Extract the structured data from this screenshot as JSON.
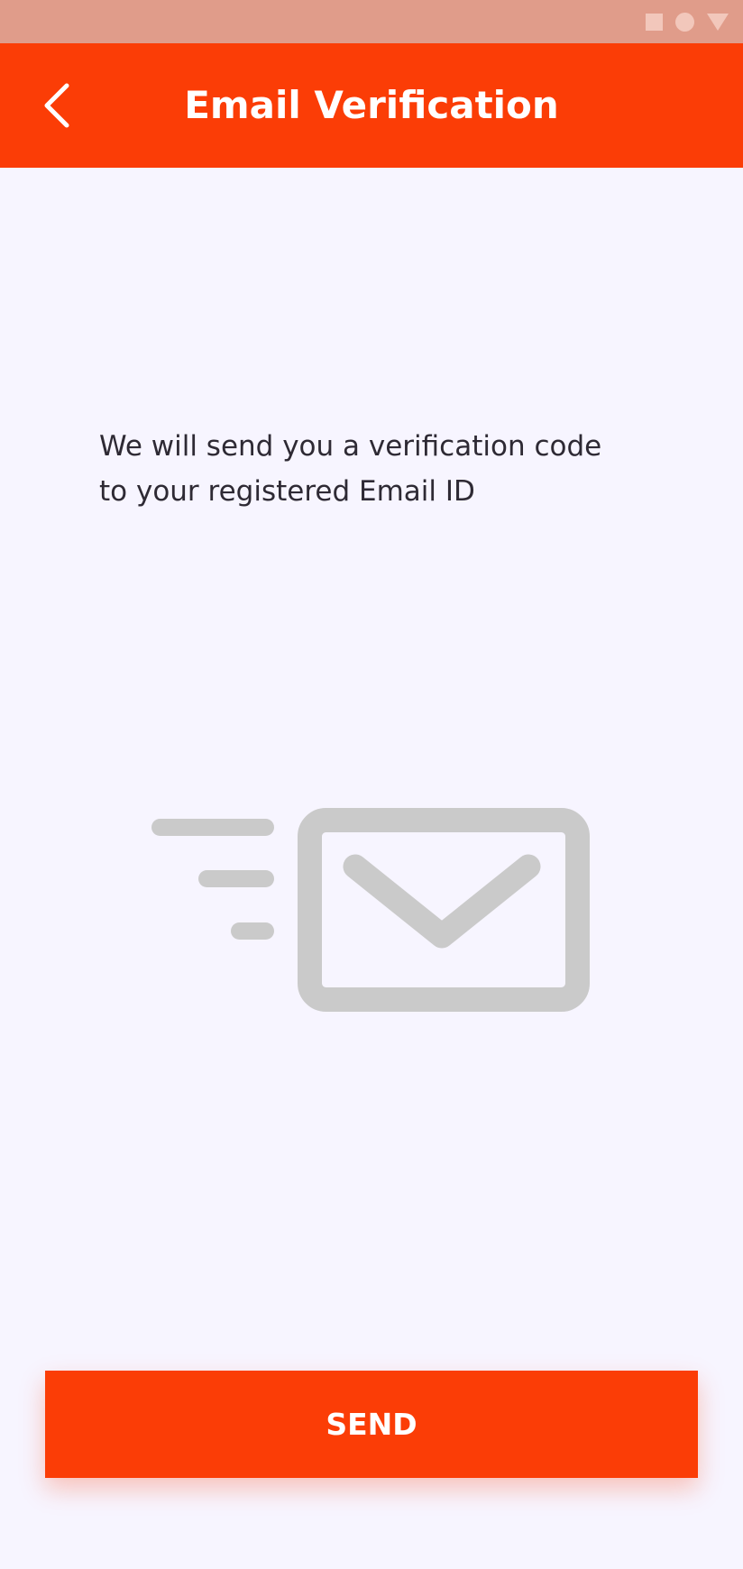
{
  "status_bar": {
    "icons": [
      "square-icon",
      "circle-icon",
      "triangle-icon"
    ]
  },
  "header": {
    "title": "Email Verification",
    "back_icon": "chevron-left-icon"
  },
  "main": {
    "description_line1": "We will send you a verification code",
    "description_line2": "to your registered Email ID",
    "illustration_icon": "email-send-icon"
  },
  "footer": {
    "send_label": "SEND"
  },
  "colors": {
    "accent": "#FB3D06",
    "status_bar": "#E09C8A",
    "background": "#F7F5FF",
    "illustration": "#CACACA",
    "text": "#2E2A34"
  }
}
